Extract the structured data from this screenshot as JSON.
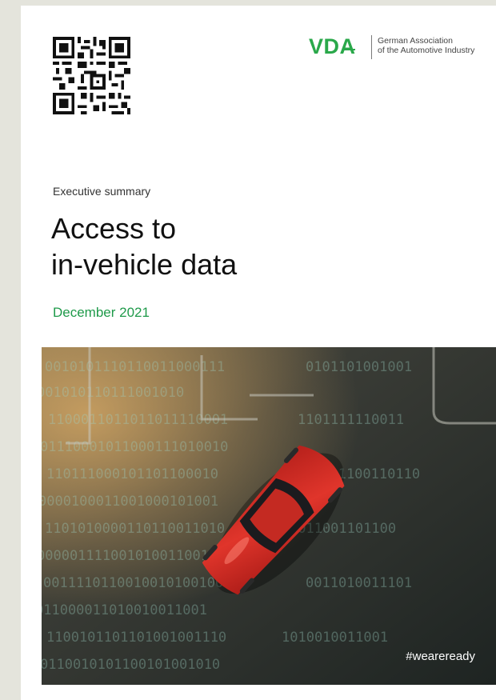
{
  "brand": {
    "logo_mark": "VDA",
    "association_line1": "German Association",
    "association_line2": "of the Automotive Industry",
    "accent_color": "#2aa84a"
  },
  "document": {
    "kicker": "Executive summary",
    "title_line1": "Access to",
    "title_line2": "in-vehicle data",
    "date": "December 2021",
    "hashtag": "#weareready"
  },
  "icons": {
    "qr": "qr-code-icon",
    "cover": "red-car-on-binary-data-image"
  }
}
